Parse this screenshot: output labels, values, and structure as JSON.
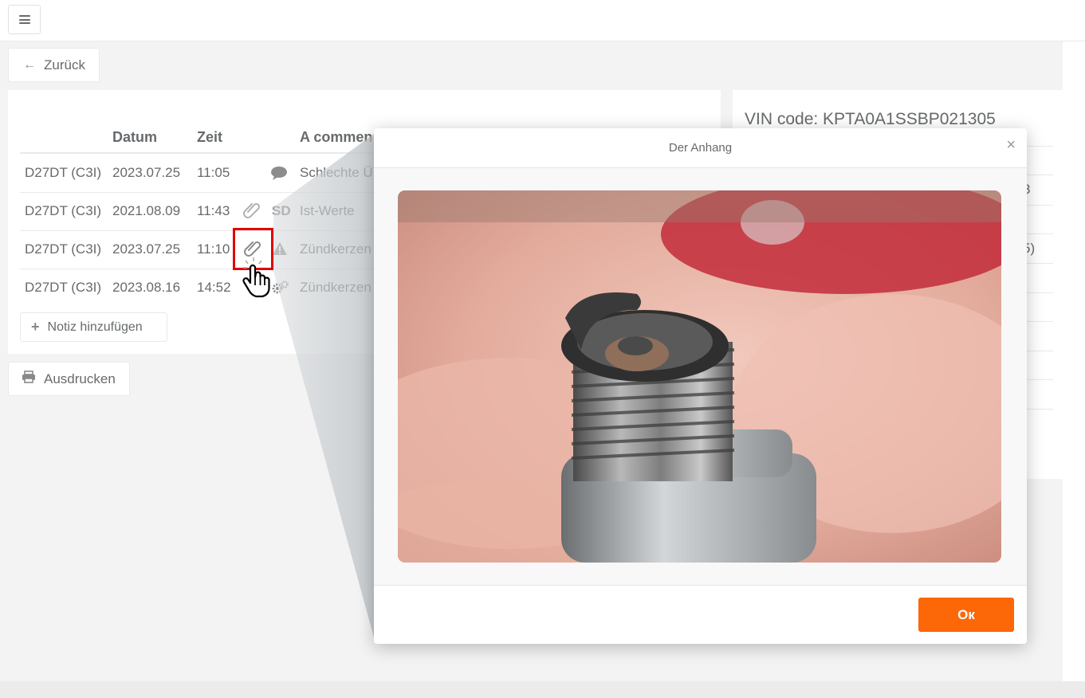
{
  "header": {
    "menu_label": "menu"
  },
  "nav": {
    "back_label": "Zurück",
    "print_label": "Ausdrucken"
  },
  "table": {
    "columns": [
      "",
      "Datum",
      "Zeit",
      "",
      "A commen"
    ],
    "rows": [
      {
        "model": "D27DT (C3I)",
        "date": "2023.07.25",
        "time": "11:05",
        "icon": "comment-icon",
        "comment": "Schlechte Ü"
      },
      {
        "model": "D27DT (C3I)",
        "date": "2021.08.09",
        "time": "11:43",
        "icon": "paperclip-icon",
        "tag": "SD",
        "comment": "Ist-Werte"
      },
      {
        "model": "D27DT (C3I)",
        "date": "2023.07.25",
        "time": "11:10",
        "icon": "warning-icon",
        "comment": "Zündkerzen"
      },
      {
        "model": "D27DT (C3I)",
        "date": "2023.08.16",
        "time": "14:52",
        "icon": "gears-icon",
        "comment": "Zündkerzen"
      }
    ],
    "add_note_label": "Notiz hinzufügen"
  },
  "vehicle": {
    "vin_text": "VIN code: KPTA0A1SSBP021305",
    "partial_values": [
      "3",
      "5)"
    ]
  },
  "modal": {
    "title": "Der Anhang",
    "close_symbol": "×",
    "ok_label": "Ок",
    "photo_subject": "spark plug in hand"
  },
  "colors": {
    "accent": "#fc6707",
    "highlight": "#e00000"
  }
}
